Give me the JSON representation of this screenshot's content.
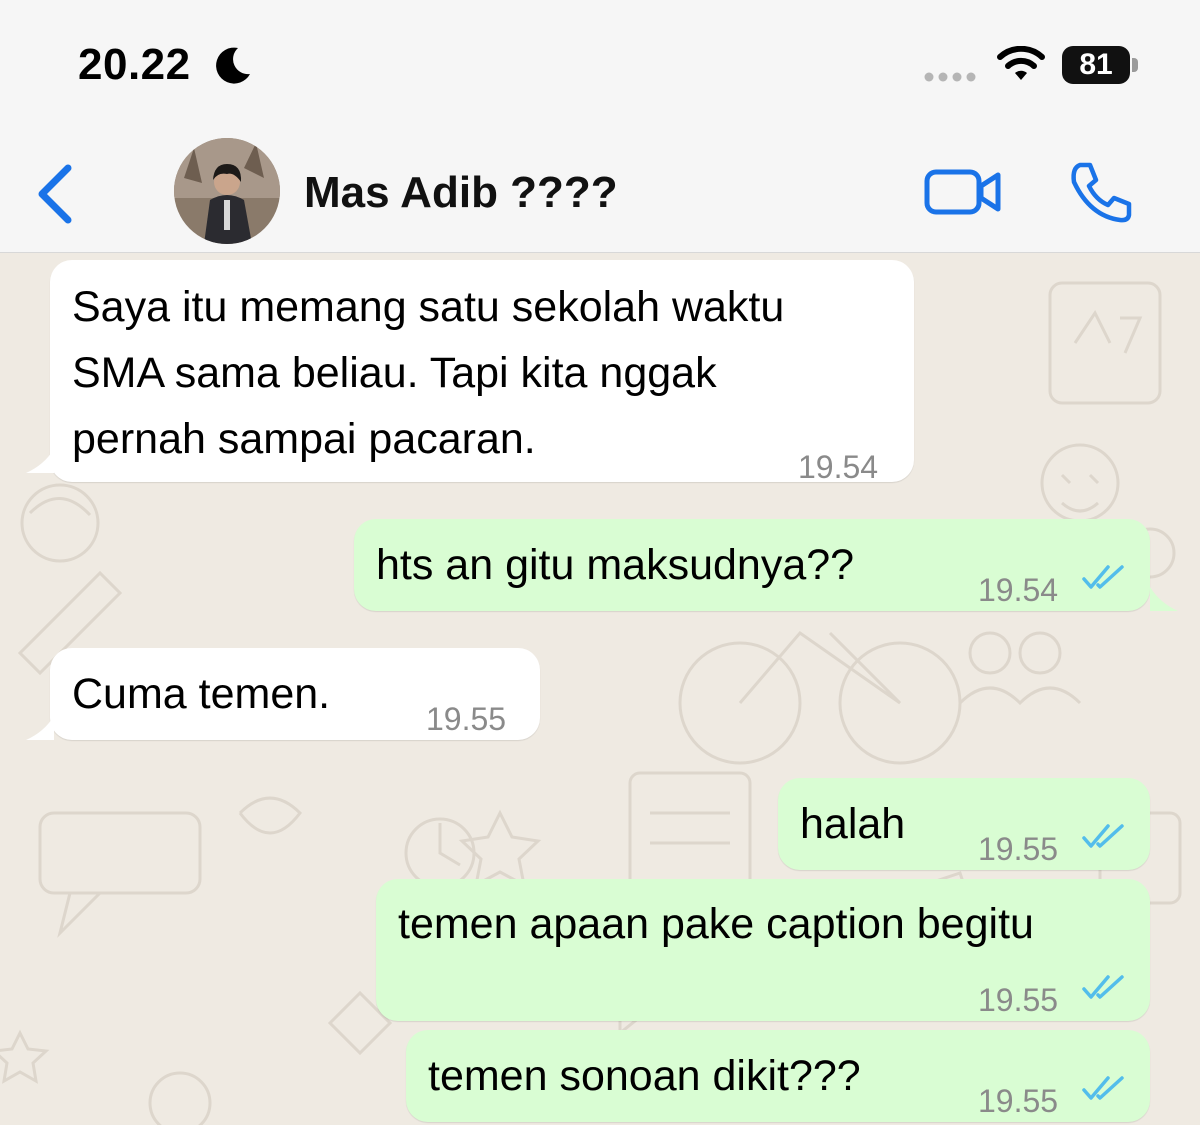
{
  "status_bar": {
    "time": "20.22",
    "battery": "81"
  },
  "header": {
    "contact_name": "Mas Adib ????"
  },
  "messages": [
    {
      "direction": "incoming",
      "lines": [
        "Saya itu memang satu sekolah waktu",
        "SMA sama beliau. Tapi kita nggak",
        "pernah sampai pacaran."
      ],
      "time": "19.54"
    },
    {
      "direction": "outgoing",
      "text": "hts an gitu maksudnya??",
      "time": "19.54",
      "status": "read"
    },
    {
      "direction": "incoming",
      "text": "Cuma temen.",
      "time": "19.55"
    },
    {
      "direction": "outgoing",
      "text": "halah",
      "time": "19.55",
      "status": "read"
    },
    {
      "direction": "outgoing",
      "text": "temen apaan pake caption begitu",
      "time": "19.55",
      "status": "read"
    },
    {
      "direction": "outgoing",
      "text": "temen sonoan dikit???",
      "time": "19.55",
      "status": "read"
    }
  ],
  "colors": {
    "accent": "#1a73e8",
    "incoming_bubble": "#ffffff",
    "outgoing_bubble": "#d9fdd3",
    "chat_background": "#efeae2",
    "read_ticks": "#53bdeb"
  },
  "icons": {
    "back": "chevron-left-icon",
    "video": "video-camera-icon",
    "call": "phone-icon",
    "dnd": "moon-icon",
    "wifi": "wifi-icon",
    "signal": "signal-dots-icon"
  }
}
